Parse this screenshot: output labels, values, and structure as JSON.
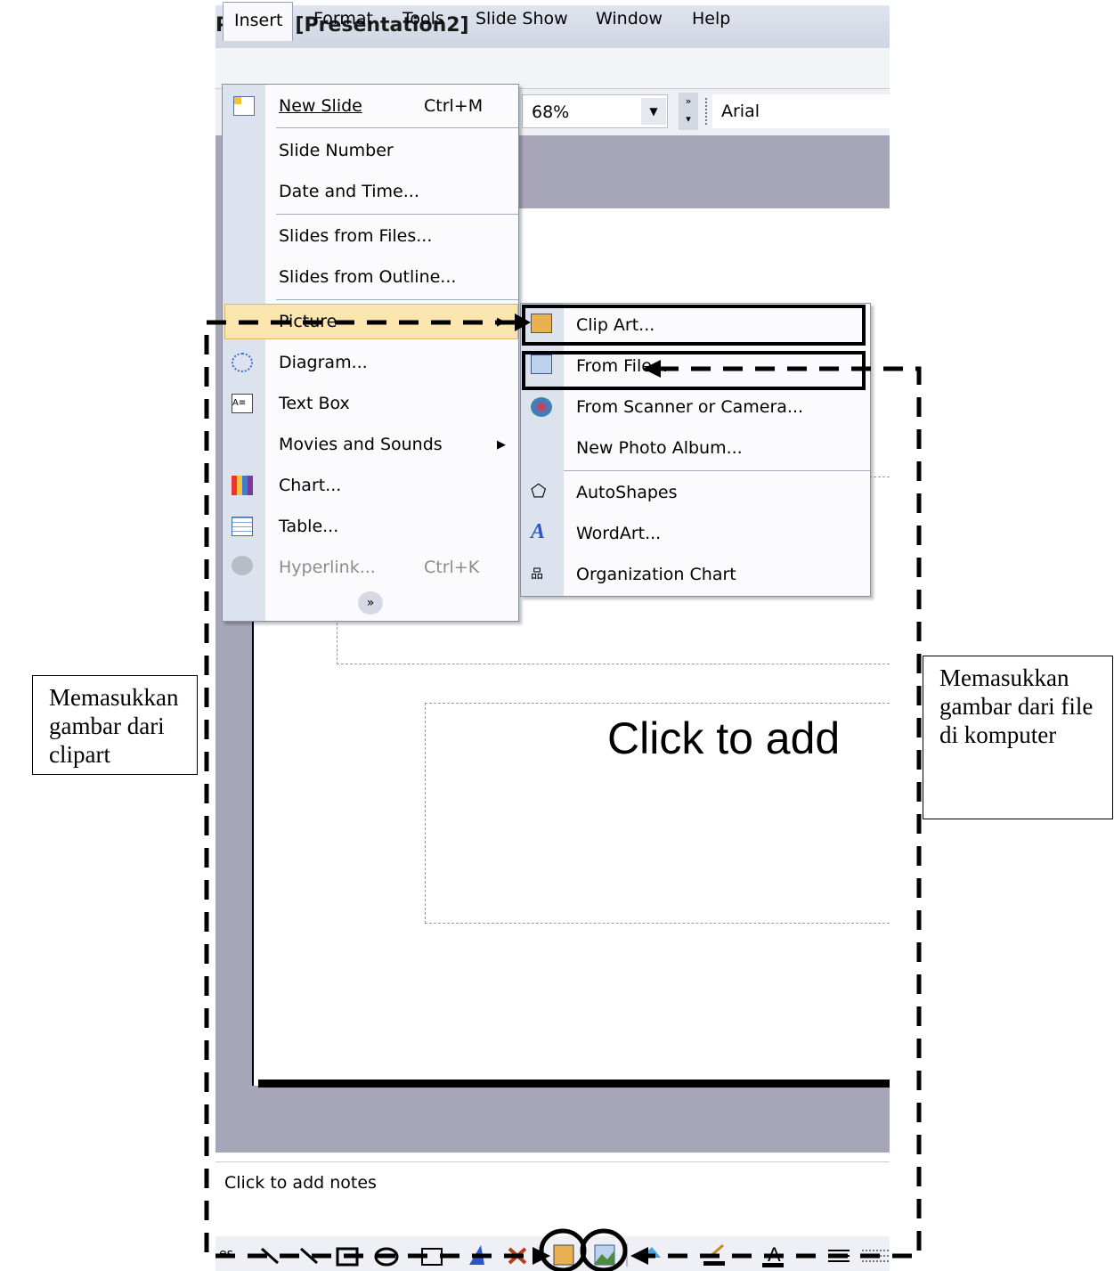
{
  "window": {
    "title": "Point - [Presentation2]"
  },
  "menubar": {
    "items": [
      "Insert",
      "Format",
      "Tools",
      "Slide Show",
      "Window",
      "Help"
    ]
  },
  "toolbar": {
    "zoom": "68%",
    "font": "Arial"
  },
  "insert_menu": {
    "new_slide": {
      "label": "New Slide",
      "shortcut": "Ctrl+M"
    },
    "slide_number": "Slide Number",
    "date_time": "Date and Time...",
    "slides_from_files": "Slides from Files...",
    "slides_from_outline": "Slides from Outline...",
    "picture": "Picture",
    "diagram": "Diagram...",
    "text_box": "Text Box",
    "movies_sounds": "Movies and Sounds",
    "chart": "Chart...",
    "table": "Table...",
    "hyperlink": {
      "label": "Hyperlink...",
      "shortcut": "Ctrl+K"
    },
    "expand_icon": "chevron-double-down-icon"
  },
  "picture_submenu": {
    "clip_art": "Clip Art...",
    "from_file": "From File...",
    "from_scanner": "From Scanner or Camera...",
    "new_photo_album": "New Photo Album...",
    "autoshapes": "AutoShapes",
    "wordart": "WordArt...",
    "org_chart": "Organization Chart"
  },
  "slide": {
    "body_placeholder": "Click to add"
  },
  "notes": {
    "placeholder": "Click to add notes"
  },
  "drawbar": {
    "left_text": "es"
  },
  "callouts": {
    "left": "Memasukkan gambar dari clipart",
    "right": "Memasukkan gambar dari file di komputer"
  },
  "colors": {
    "menu_highlight": "#fbe6b0",
    "workspace": "#a6a6b8",
    "menu_strip": "#dde3ee"
  }
}
